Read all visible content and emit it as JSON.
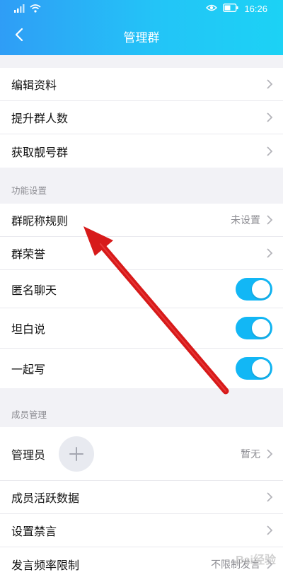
{
  "status": {
    "time": "16:26"
  },
  "title": "管理群",
  "group1": {
    "items": [
      {
        "label": "编辑资料"
      },
      {
        "label": "提升群人数"
      },
      {
        "label": "获取靓号群"
      }
    ]
  },
  "section_function": {
    "label": "功能设置",
    "items": [
      {
        "label": "群昵称规则",
        "value": "未设置"
      },
      {
        "label": "群荣誉"
      },
      {
        "label": "匿名聊天",
        "toggle": true
      },
      {
        "label": "坦白说",
        "toggle": true
      },
      {
        "label": "一起写",
        "toggle": true
      }
    ]
  },
  "section_member": {
    "label": "成员管理",
    "admin": {
      "label": "管理员",
      "value": "暂无"
    },
    "items": [
      {
        "label": "成员活跃数据"
      },
      {
        "label": "设置禁言"
      },
      {
        "label": "发言频率限制",
        "value": "不限制发言"
      }
    ]
  },
  "colors": {
    "header_start": "#2f9df6",
    "header_end": "#1cd2f5",
    "toggle_on": "#12b7f5",
    "annotation_arrow": "#e01e1e"
  },
  "watermark": "Bai经验"
}
